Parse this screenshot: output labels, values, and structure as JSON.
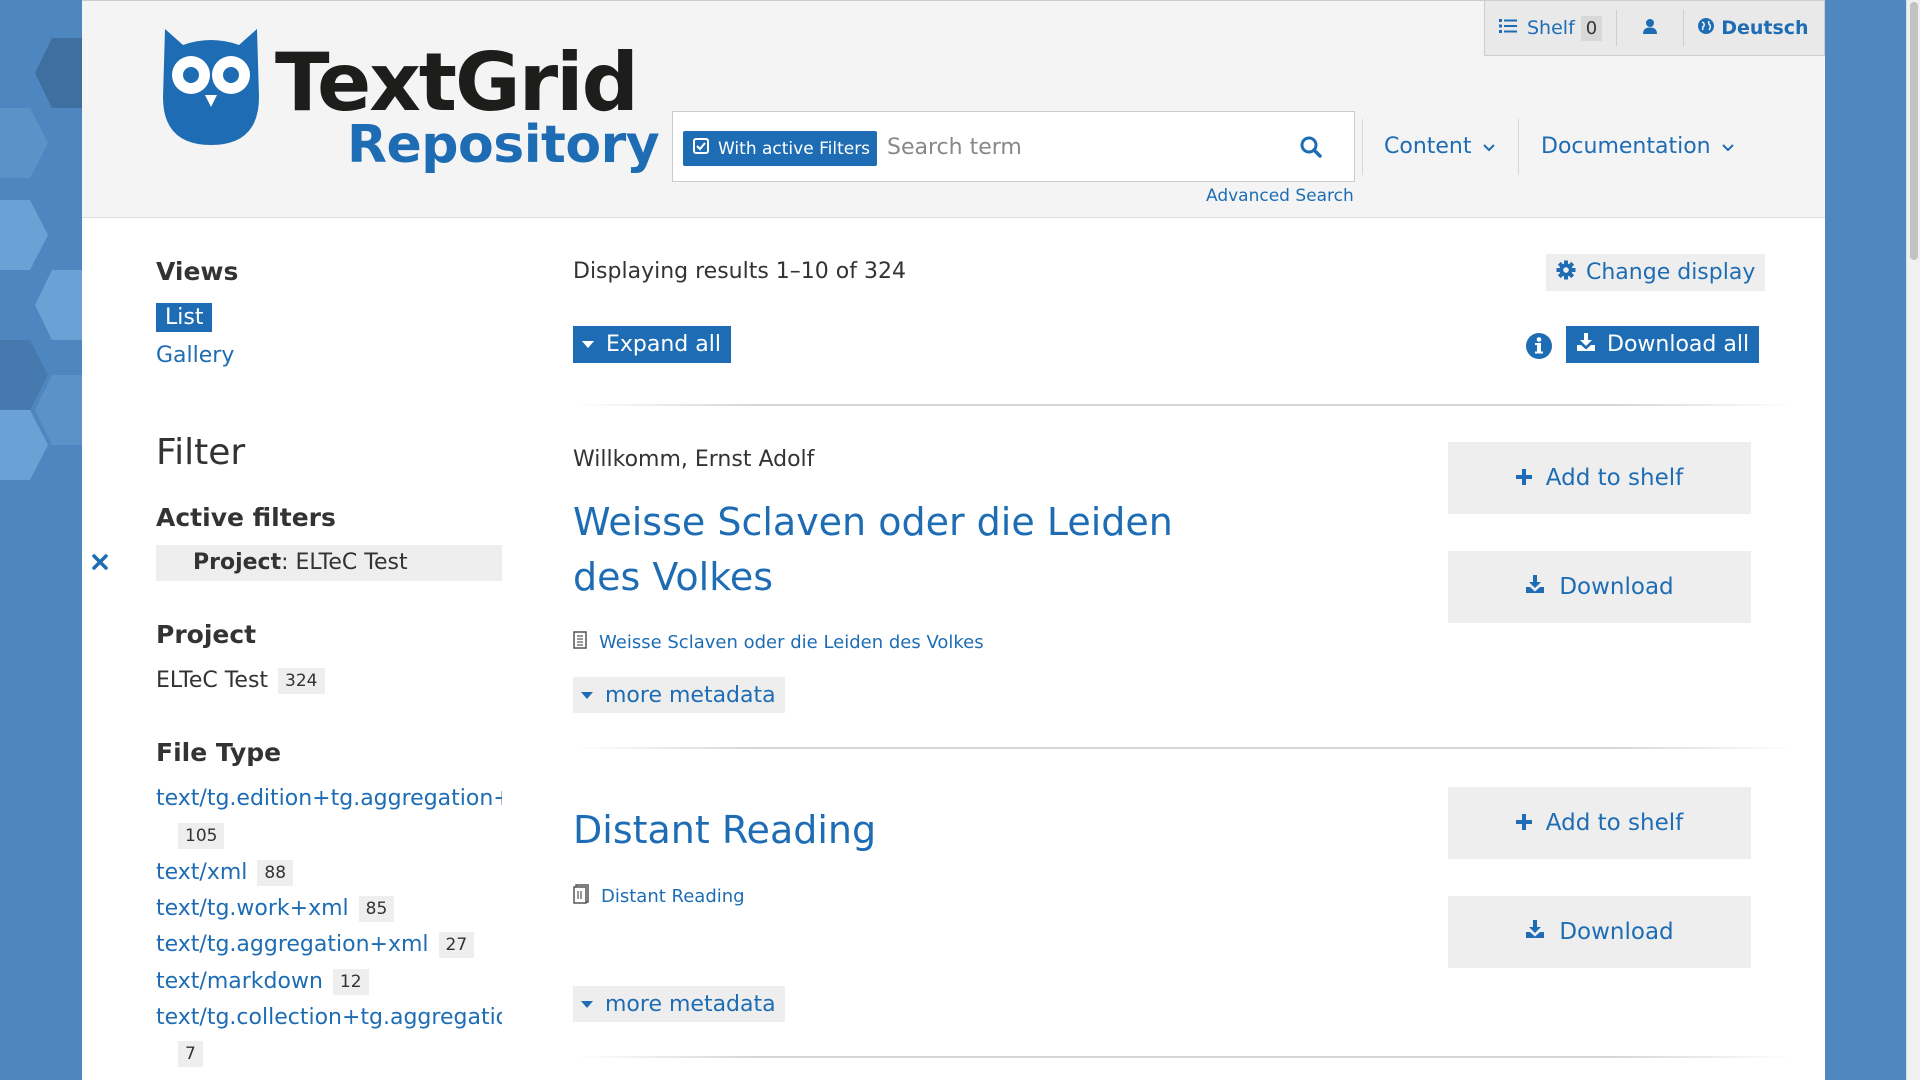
{
  "header": {
    "logo_line1": "TextGrid",
    "logo_line2": "Repository",
    "shelf_label": "Shelf",
    "shelf_count": "0",
    "language_label": "Deutsch",
    "filter_toggle_label": "With active Filters",
    "search_placeholder": "Search term",
    "advanced_search_label": "Advanced Search",
    "nav": {
      "content_label": "Content",
      "documentation_label": "Documentation"
    }
  },
  "sidebar": {
    "views_heading": "Views",
    "views": [
      "List",
      "Gallery"
    ],
    "filter_heading": "Filter",
    "active_filters_heading": "Active filters",
    "active_filter": {
      "field": "Project",
      "separator": ":",
      "value": " ELTeC Test"
    },
    "project_heading": "Project",
    "project_facet": {
      "label": "ELTeC Test",
      "count": "324"
    },
    "filetype_heading": "File Type",
    "filetypes": [
      {
        "label": "text/tg.edition+tg.aggregation+xn",
        "count": "105"
      },
      {
        "label": "text/xml",
        "count": "88"
      },
      {
        "label": "text/tg.work+xml",
        "count": "85"
      },
      {
        "label": "text/tg.aggregation+xml",
        "count": "27"
      },
      {
        "label": "text/markdown",
        "count": "12"
      },
      {
        "label": "text/tg.collection+tg.aggregation+",
        "count": "7"
      }
    ]
  },
  "main": {
    "results_summary": "Displaying results 1–10 of 324",
    "change_display_label": "Change display",
    "expand_all_label": "Expand all",
    "download_all_label": "Download all",
    "results": [
      {
        "author": "Willkomm, Ernst Adolf",
        "title_line1": "Weisse Sclaven oder die Leiden",
        "title_line2": "des Volkes",
        "sub_label": "Weisse Sclaven oder die Leiden des Volkes",
        "more_metadata_label": "more metadata",
        "add_to_shelf_label": "Add to shelf",
        "download_label": "Download"
      },
      {
        "title_line1": "Distant Reading",
        "sub_label": "Distant Reading",
        "more_metadata_label": "more metadata",
        "add_to_shelf_label": "Add to shelf",
        "download_label": "Download"
      }
    ]
  },
  "colors": {
    "accent": "#1e6db4",
    "background_blue": "#4e86bf",
    "panel_gray": "#eeeeee"
  }
}
